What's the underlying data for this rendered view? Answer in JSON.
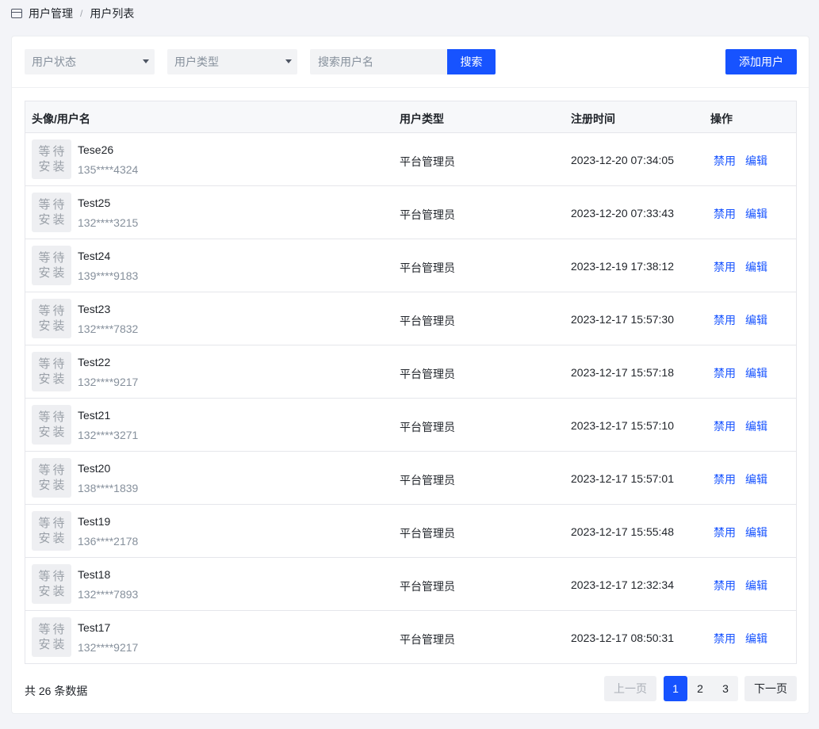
{
  "breadcrumb": {
    "root": "用户管理",
    "separator": "/",
    "current": "用户列表"
  },
  "filters": {
    "status_placeholder": "用户状态",
    "type_placeholder": "用户类型",
    "search_placeholder": "搜索用户名",
    "search_label": "搜索",
    "add_label": "添加用户"
  },
  "table": {
    "headers": {
      "user": "头像/用户名",
      "type": "用户类型",
      "time": "注册时间",
      "actions": "操作"
    },
    "avatar_placeholder_line1": "等待",
    "avatar_placeholder_line2": "安装",
    "action_disable": "禁用",
    "action_edit": "编辑",
    "rows": [
      {
        "name": "Tese26",
        "phone": "135****4324",
        "type": "平台管理员",
        "time": "2023-12-20 07:34:05"
      },
      {
        "name": "Test25",
        "phone": "132****3215",
        "type": "平台管理员",
        "time": "2023-12-20 07:33:43"
      },
      {
        "name": "Test24",
        "phone": "139****9183",
        "type": "平台管理员",
        "time": "2023-12-19 17:38:12"
      },
      {
        "name": "Test23",
        "phone": "132****7832",
        "type": "平台管理员",
        "time": "2023-12-17 15:57:30"
      },
      {
        "name": "Test22",
        "phone": "132****9217",
        "type": "平台管理员",
        "time": "2023-12-17 15:57:18"
      },
      {
        "name": "Test21",
        "phone": "132****3271",
        "type": "平台管理员",
        "time": "2023-12-17 15:57:10"
      },
      {
        "name": "Test20",
        "phone": "138****1839",
        "type": "平台管理员",
        "time": "2023-12-17 15:57:01"
      },
      {
        "name": "Test19",
        "phone": "136****2178",
        "type": "平台管理员",
        "time": "2023-12-17 15:55:48"
      },
      {
        "name": "Test18",
        "phone": "132****7893",
        "type": "平台管理员",
        "time": "2023-12-17 12:32:34"
      },
      {
        "name": "Test17",
        "phone": "132****9217",
        "type": "平台管理员",
        "time": "2023-12-17 08:50:31"
      }
    ]
  },
  "pagination": {
    "total_text": "共 26 条数据",
    "prev_label": "上一页",
    "next_label": "下一页",
    "pages": [
      "1",
      "2",
      "3"
    ],
    "current_page": "1"
  },
  "colors": {
    "primary": "#1753ff",
    "background": "#f3f4f8",
    "muted": "#86909c"
  },
  "icons": {
    "breadcrumb": "window-icon",
    "select_caret": "caret-down-icon"
  }
}
